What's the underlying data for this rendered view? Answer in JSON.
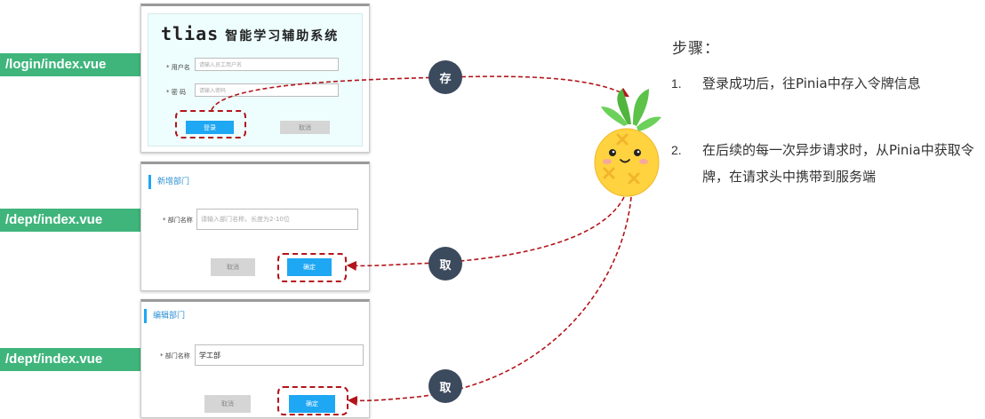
{
  "labels": {
    "login_path": "/login/index.vue",
    "dept_add_path": "/dept/index.vue",
    "dept_edit_path": "/dept/index.vue"
  },
  "login": {
    "title_en": "tlias",
    "title_cn": "智能学习辅助系统",
    "username_label": "* 用户名",
    "username_placeholder": "请输入员工用户名",
    "password_label": "* 密   码",
    "password_placeholder": "请输入密码",
    "login_button": "登录",
    "cancel_button": "取消"
  },
  "add_dialog": {
    "title": "新增部门",
    "name_label": "* 部门名称",
    "name_placeholder": "请输入部门名称，长度为2-10位",
    "cancel_button": "取消",
    "confirm_button": "确定"
  },
  "edit_dialog": {
    "title": "编辑部门",
    "name_label": "* 部门名称",
    "name_value": "学工部",
    "cancel_button": "取消",
    "confirm_button": "确定"
  },
  "badges": {
    "store": "存",
    "fetch1": "取",
    "fetch2": "取"
  },
  "steps": {
    "title": "步骤：",
    "items": [
      {
        "num": "1.",
        "text": "登录成功后，往Pinia中存入令牌信息"
      },
      {
        "num": "2.",
        "text": "在后续的每一次异步请求时，从Pinia中获取令牌，在请求头中携带到服务端"
      }
    ]
  },
  "colors": {
    "label_bg": "#3fb57c",
    "primary": "#1ea7f3",
    "dash_red": "#b3141a",
    "badge_bg": "#3b4a5c",
    "pineapple_body": "#ffd23f",
    "pineapple_leaf": "#5cc24a"
  }
}
